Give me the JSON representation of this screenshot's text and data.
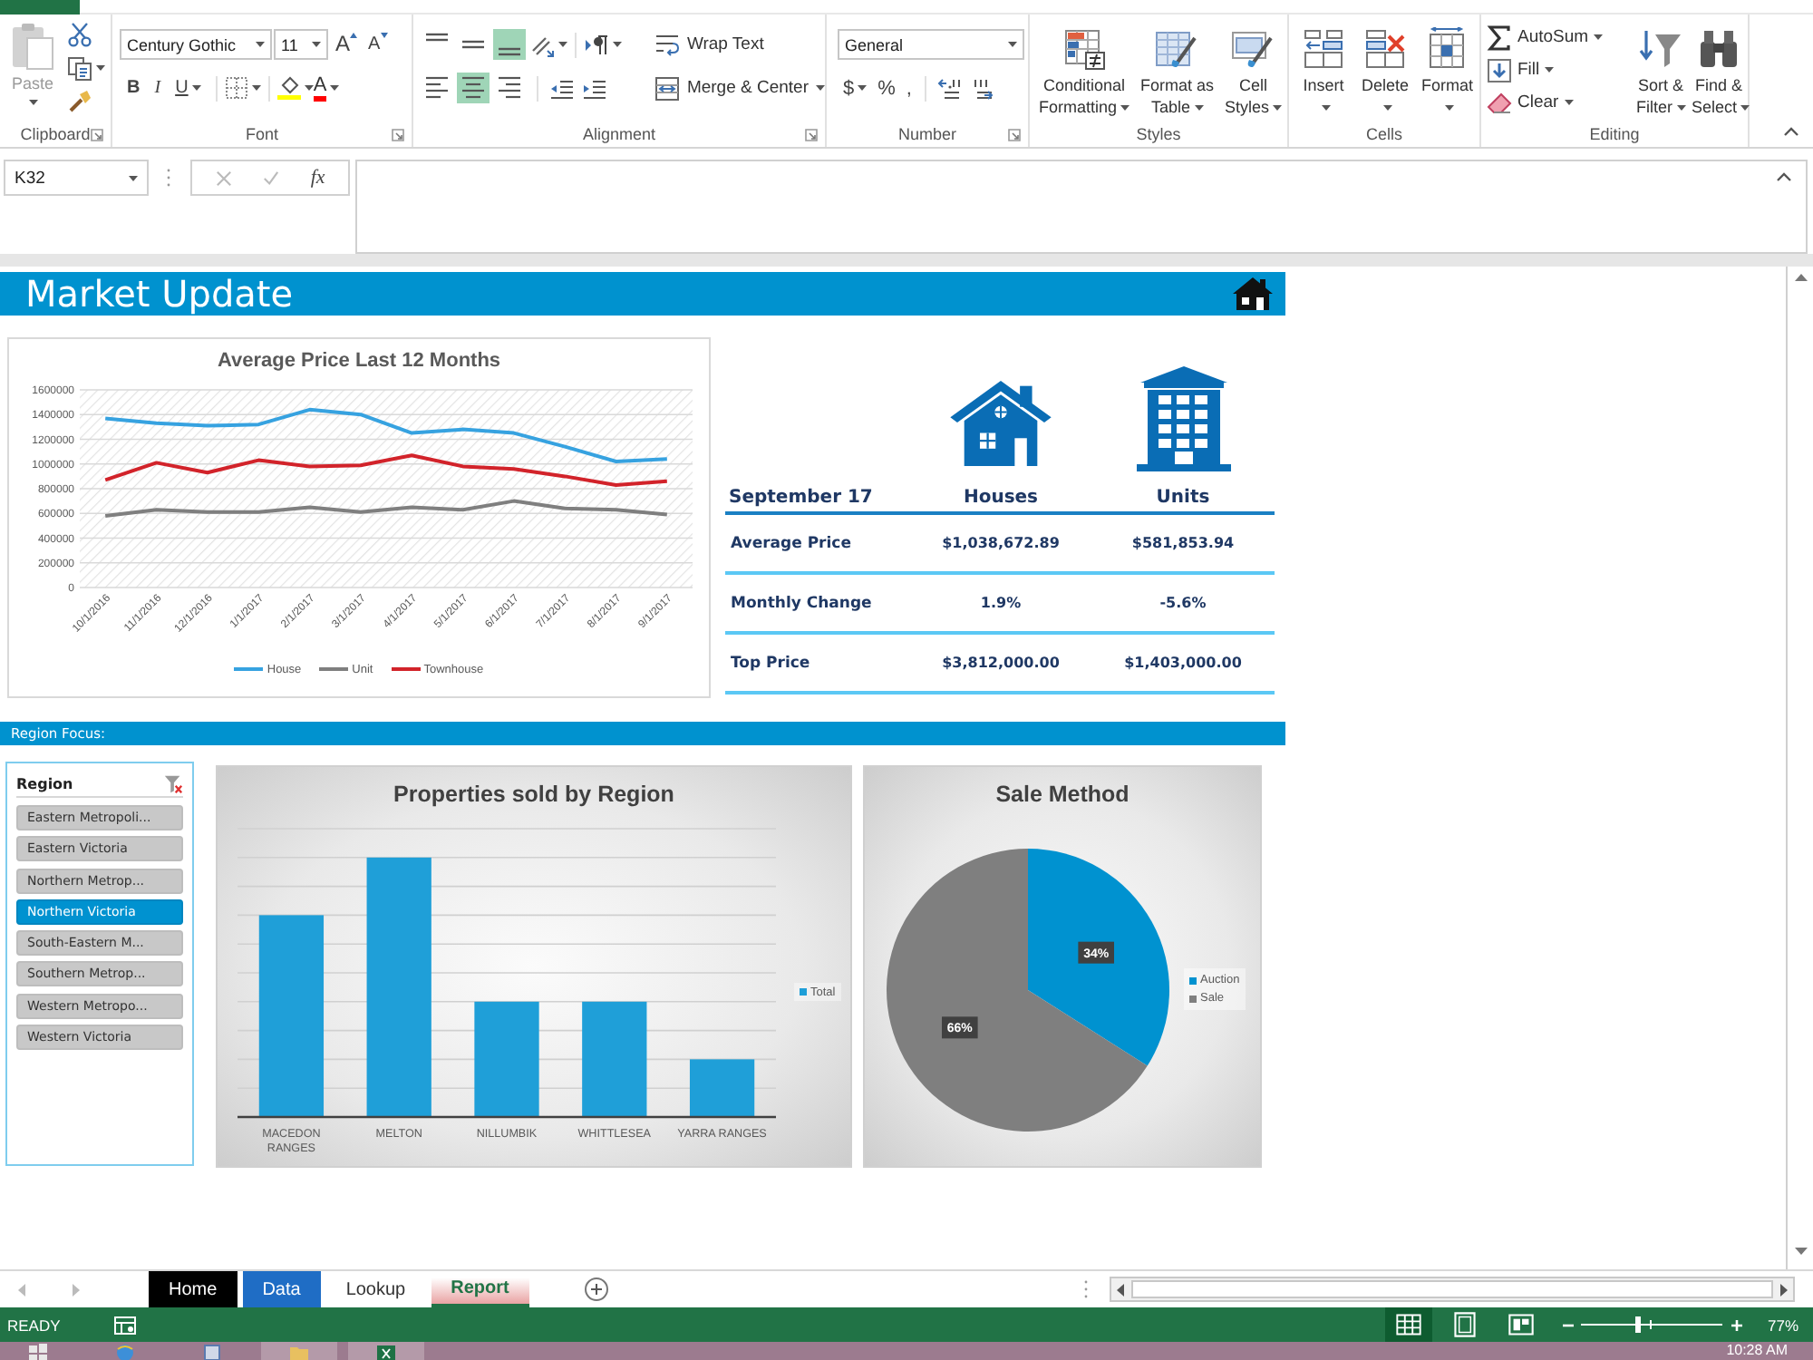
{
  "ribbon": {
    "clipboard": {
      "label": "Clipboard",
      "paste": {
        "label": "Paste",
        "disabled": true
      }
    },
    "font": {
      "label": "Font",
      "font_name": "Century Gothic",
      "font_size": "11",
      "grow_font": "A",
      "shrink_font": "A",
      "styles": [
        {
          "kind": "bold",
          "label": "B"
        },
        {
          "kind": "italic",
          "label": "I"
        },
        {
          "kind": "underline",
          "label": "U"
        }
      ],
      "font_color": "A"
    },
    "alignment": {
      "label": "Alignment",
      "vertical": [
        {
          "kind": "top",
          "selected": false
        },
        {
          "kind": "middle",
          "selected": false
        },
        {
          "kind": "bottom",
          "selected": true
        }
      ],
      "horizontal": [
        {
          "kind": "left",
          "selected": false
        },
        {
          "kind": "center",
          "selected": true
        },
        {
          "kind": "right",
          "selected": false
        }
      ],
      "wrap_text": "Wrap Text",
      "merge": "Merge & Center"
    },
    "number": {
      "label": "Number",
      "format": "General",
      "symbols": [
        {
          "kind": "currency",
          "label": "$"
        },
        {
          "kind": "percent",
          "label": "%"
        },
        {
          "kind": "comma",
          "label": ","
        }
      ]
    },
    "styles": {
      "label": "Styles",
      "buttons": [
        {
          "kind": "conditional",
          "lines": [
            "Conditional",
            "Formatting"
          ]
        },
        {
          "kind": "table",
          "lines": [
            "Format as",
            "Table"
          ]
        },
        {
          "kind": "cell",
          "lines": [
            "Cell",
            "Styles"
          ]
        }
      ]
    },
    "cells": {
      "label": "Cells",
      "buttons": [
        {
          "kind": "insert",
          "label": "Insert"
        },
        {
          "kind": "delete",
          "label": "Delete"
        },
        {
          "kind": "format",
          "label": "Format"
        }
      ]
    },
    "editing": {
      "label": "Editing",
      "small": [
        {
          "kind": "autosum",
          "label": "AutoSum"
        },
        {
          "kind": "fill",
          "label": "Fill"
        },
        {
          "kind": "clear",
          "label": "Clear"
        }
      ],
      "big": [
        {
          "kind": "sort",
          "lines": [
            "Sort &",
            "Filter"
          ]
        },
        {
          "kind": "find",
          "lines": [
            "Find &",
            "Select"
          ]
        }
      ]
    }
  },
  "formula_bar": {
    "name_box": "K32",
    "function_label": "fx"
  },
  "banner": {
    "title": "Market Update"
  },
  "price_chart": {
    "chart_data": [
      {
        "type": "line",
        "title": "Average Price Last 12 Months",
        "categories": [
          "10/1/2016",
          "11/1/2016",
          "12/1/2016",
          "1/1/2017",
          "2/1/2017",
          "3/1/2017",
          "4/1/2017",
          "5/1/2017",
          "6/1/2017",
          "7/1/2017",
          "8/1/2017",
          "9/1/2017"
        ],
        "series": [
          {
            "name": "House",
            "color": "#36a2e0",
            "values": [
              1370000,
              1330000,
              1310000,
              1320000,
              1440000,
              1400000,
              1250000,
              1280000,
              1250000,
              1140000,
              1020000,
              1040000
            ]
          },
          {
            "name": "Unit",
            "color": "#7f7f7f",
            "values": [
              580000,
              630000,
              610000,
              610000,
              650000,
              610000,
              650000,
              630000,
              700000,
              640000,
              630000,
              590000
            ]
          },
          {
            "name": "Townhouse",
            "color": "#d2232a",
            "values": [
              870000,
              1010000,
              930000,
              1030000,
              980000,
              990000,
              1070000,
              980000,
              960000,
              900000,
              830000,
              860000
            ]
          }
        ],
        "ylim": [
          0,
          1600000
        ],
        "yticks": [
          0,
          200000,
          400000,
          600000,
          800000,
          1000000,
          1200000,
          1400000,
          1600000
        ],
        "grid": true,
        "legend": "bottom"
      }
    ]
  },
  "summary": {
    "columns": [
      "September 17",
      "Houses",
      "Units"
    ],
    "rows": [
      {
        "label": "Average Price",
        "values": [
          "$1,038,672.89",
          "$581,853.94"
        ]
      },
      {
        "label": "Monthly Change",
        "values": [
          "1.9%",
          "-5.6%"
        ]
      },
      {
        "label": "Top Price",
        "values": [
          "$3,812,000.00",
          "$1,403,000.00"
        ]
      }
    ]
  },
  "region_bar": {
    "label": "Region Focus:"
  },
  "slicer": {
    "title": "Region",
    "items": [
      {
        "label": "Eastern Metropoli...",
        "selected": false
      },
      {
        "label": "Eastern Victoria",
        "selected": false
      },
      {
        "label": "Northern Metrop...",
        "selected": false
      },
      {
        "label": "Northern Victoria",
        "selected": true
      },
      {
        "label": "South-Eastern M...",
        "selected": false
      },
      {
        "label": "Southern Metrop...",
        "selected": false
      },
      {
        "label": "Western Metropo...",
        "selected": false
      },
      {
        "label": "Western Victoria",
        "selected": false
      }
    ]
  },
  "bar_chart": {
    "title": "Properties sold by Region",
    "categories": [
      "MACEDON RANGES",
      "MELTON",
      "NILLUMBIK",
      "WHITTLESEA",
      "YARRA RANGES"
    ],
    "legend": "Total"
  },
  "sale_chart": {
    "chart_data": [
      {
        "type": "pie",
        "title": "Sale Method",
        "categories": [
          "Auction",
          "Sale"
        ],
        "values": [
          34,
          66
        ],
        "colors": [
          "#0092d0",
          "#7f7f7f"
        ],
        "value_labels": [
          "34%",
          "66%"
        ],
        "legend": "right"
      }
    ]
  },
  "sheet_tabs": [
    {
      "label": "Home",
      "selected": false,
      "color": "#000000"
    },
    {
      "label": "Data",
      "selected": false,
      "color": "#1f6dc5"
    },
    {
      "label": "Lookup",
      "selected": false
    },
    {
      "label": "Report",
      "selected": true,
      "color": "#e9a3a3"
    }
  ],
  "status_bar": {
    "mode": "READY",
    "views": [
      {
        "kind": "normal",
        "selected": true
      },
      {
        "kind": "page_layout",
        "selected": false
      },
      {
        "kind": "page_break",
        "selected": false
      }
    ],
    "zoom_slider": {
      "level": 0.4
    },
    "zoom": "77%"
  },
  "taskbar": {
    "apps": [
      {
        "kind": "start",
        "open": false
      },
      {
        "kind": "browser",
        "open": false
      },
      {
        "kind": "window",
        "open": false
      },
      {
        "kind": "folder",
        "open": true
      },
      {
        "kind": "spreadsheet",
        "open": true
      }
    ],
    "clock": "10:28 AM"
  }
}
